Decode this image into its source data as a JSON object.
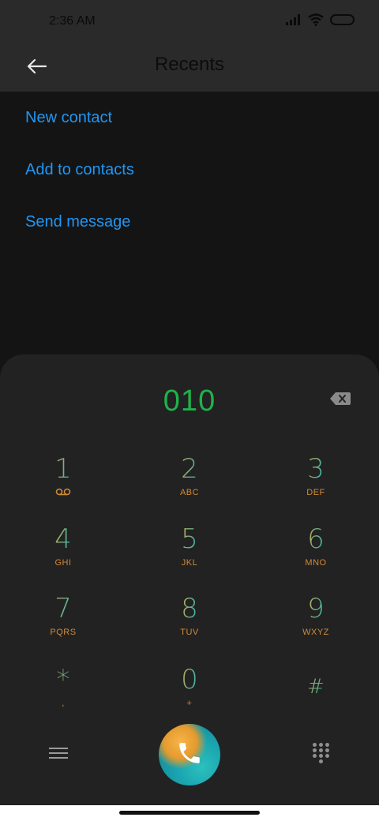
{
  "status_bar": {
    "time": "2:36 AM",
    "icons": [
      "signal-icon",
      "wifi-icon",
      "battery-icon"
    ]
  },
  "app_bar": {
    "title": "Recents",
    "back_icon": "arrow-left-icon"
  },
  "actions": [
    {
      "label": "New contact"
    },
    {
      "label": "Add to contacts"
    },
    {
      "label": "Send message"
    }
  ],
  "dialer": {
    "number": "010",
    "backspace_icon": "backspace-icon",
    "keys": [
      {
        "digit": "1",
        "letters": "",
        "sub_icon": "voicemail-icon"
      },
      {
        "digit": "2",
        "letters": "ABC"
      },
      {
        "digit": "3",
        "letters": "DEF"
      },
      {
        "digit": "4",
        "letters": "GHI"
      },
      {
        "digit": "5",
        "letters": "JKL"
      },
      {
        "digit": "6",
        "letters": "MNO"
      },
      {
        "digit": "7",
        "letters": "PQRS"
      },
      {
        "digit": "8",
        "letters": "TUV"
      },
      {
        "digit": "9",
        "letters": "WXYZ"
      },
      {
        "digit": "*",
        "letters": ","
      },
      {
        "digit": "0",
        "letters": "+"
      },
      {
        "digit": "#",
        "letters": ""
      }
    ],
    "menu_icon": "menu-icon",
    "call_icon": "phone-icon",
    "keypad_icon": "dialpad-icon"
  },
  "colors": {
    "accent_blue": "#2196f3",
    "number_green": "#1fb24a",
    "key_orange": "#f2a233",
    "key_teal": "#2ab6b6"
  }
}
